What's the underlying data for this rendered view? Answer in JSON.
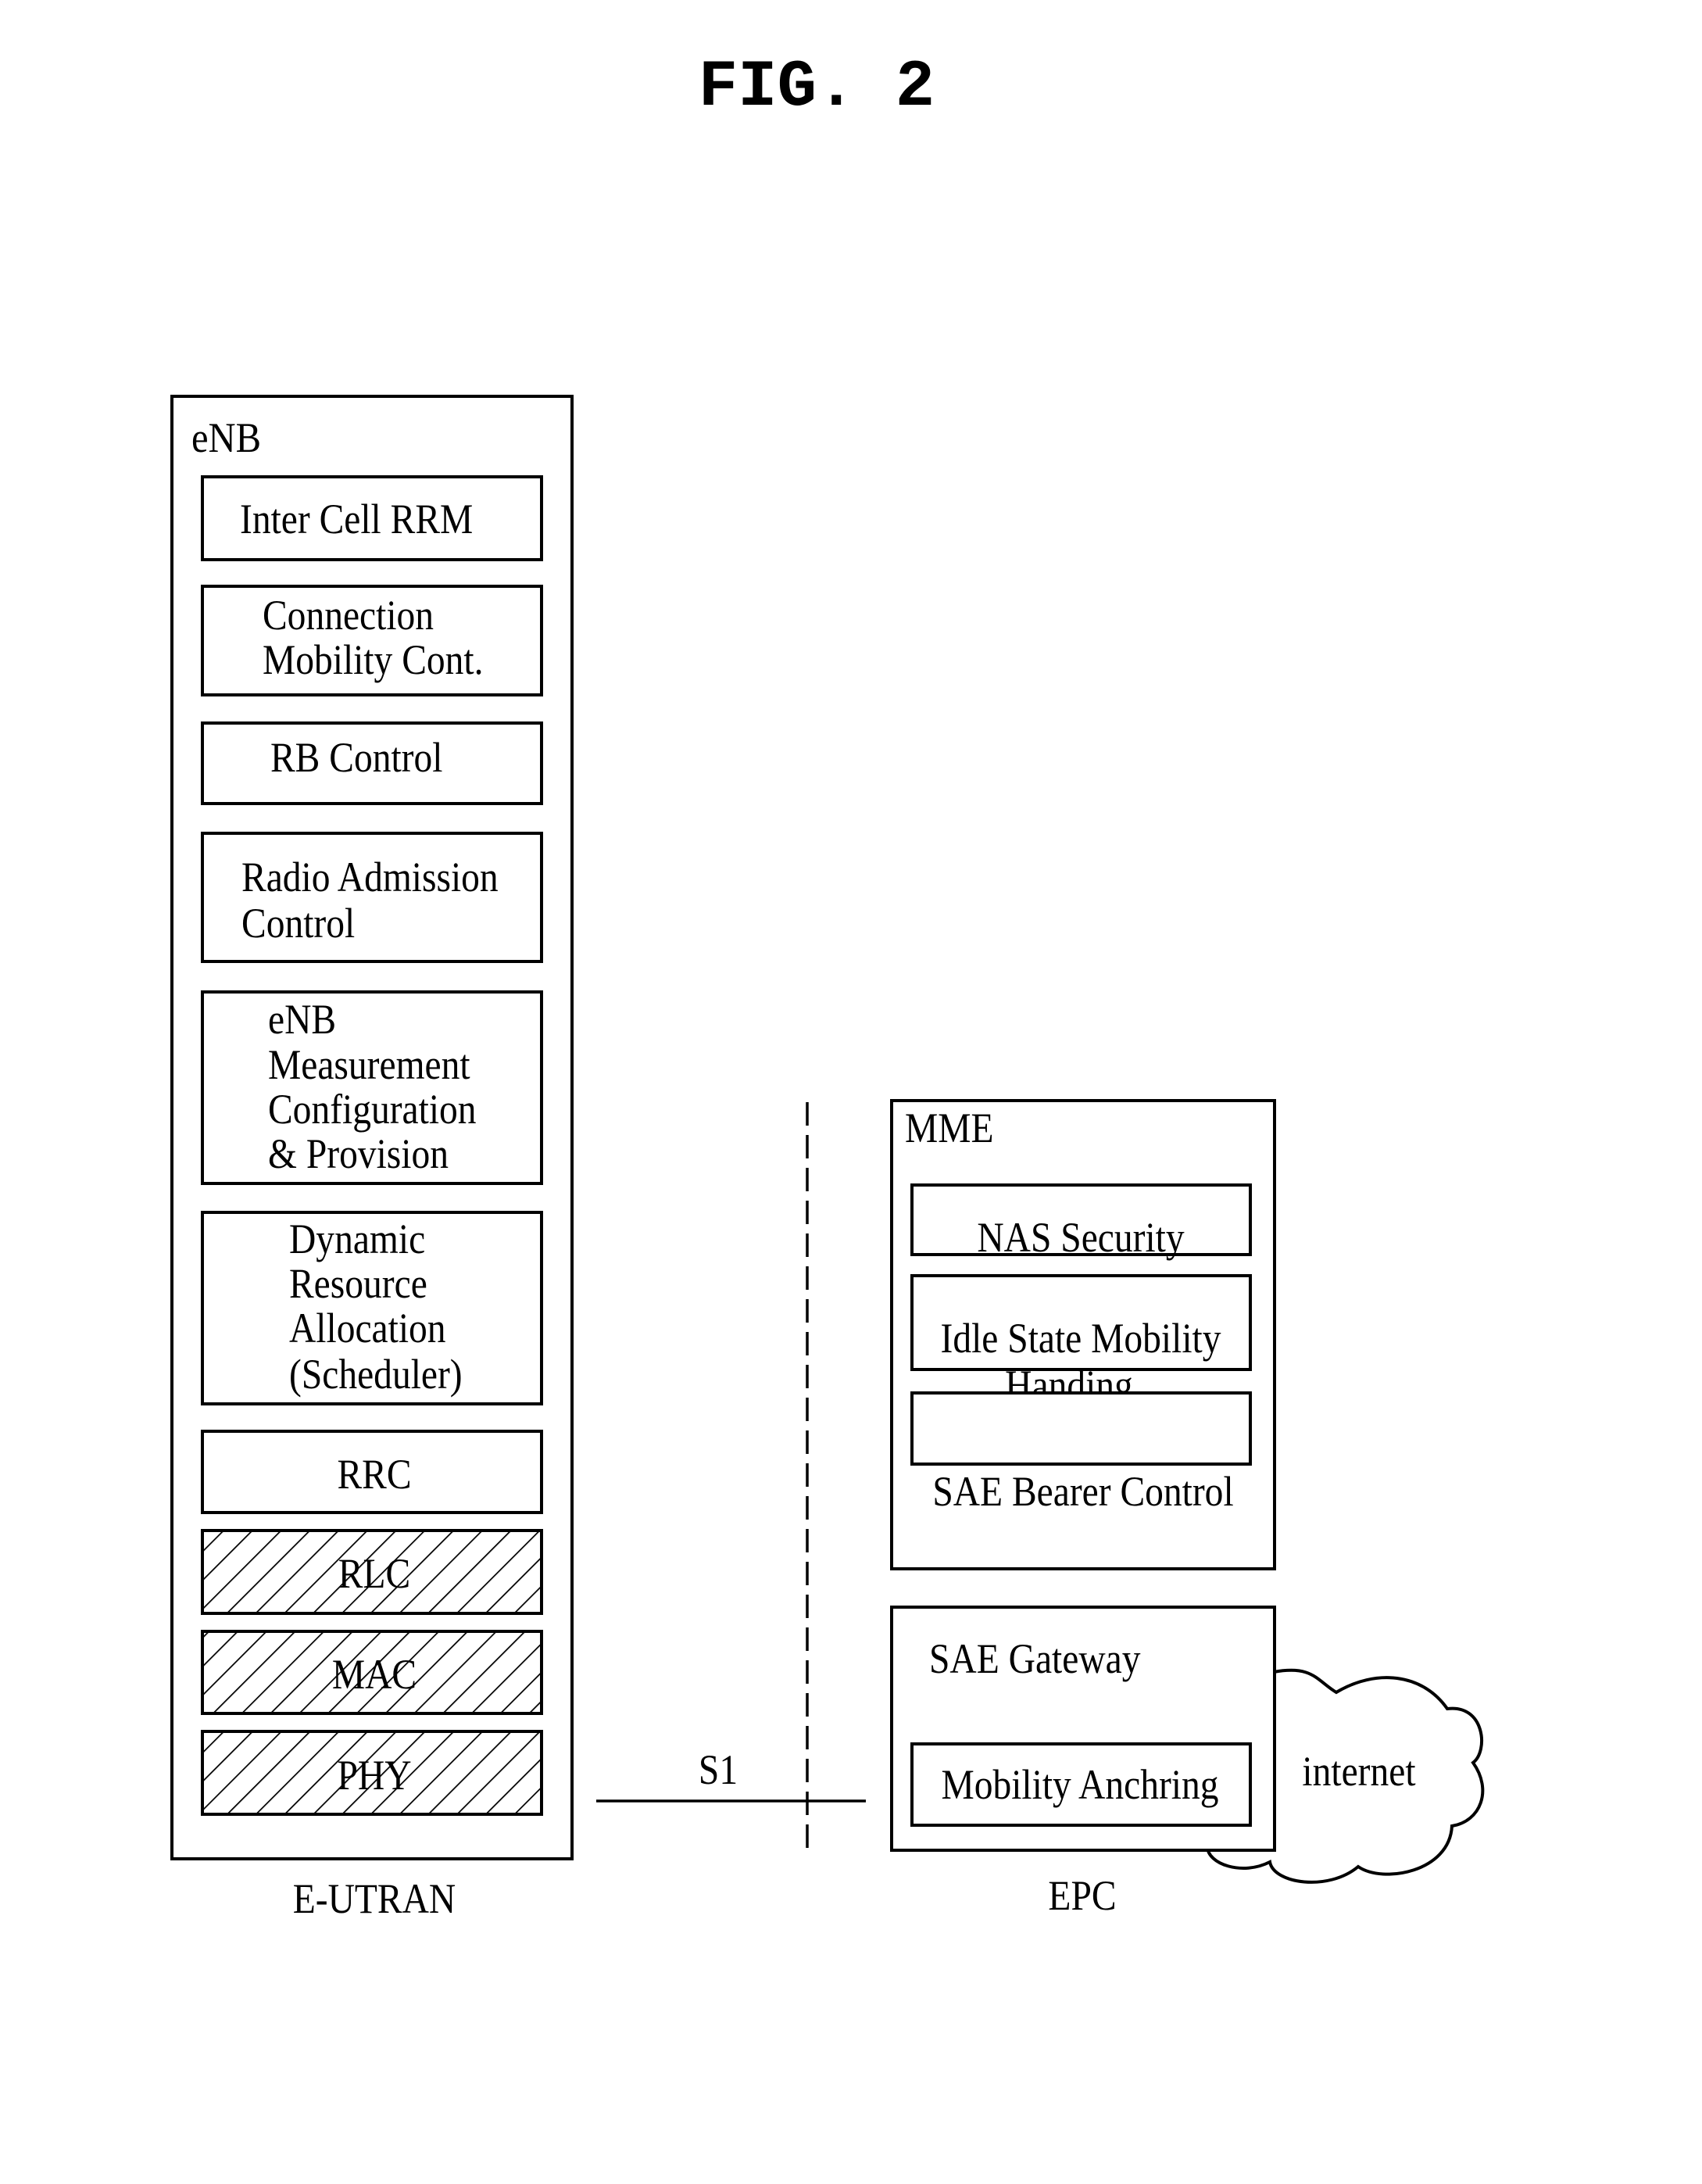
{
  "figure": {
    "title": "FIG. 2"
  },
  "eutran": {
    "caption": "E-UTRAN",
    "enb": {
      "label": "eNB",
      "functions": [
        {
          "lines": [
            "Inter Cell RRM"
          ],
          "hatched": false
        },
        {
          "lines": [
            "Connection",
            "Mobility Cont."
          ],
          "hatched": false
        },
        {
          "lines": [
            "RB Control"
          ],
          "hatched": false
        },
        {
          "lines": [
            "Radio Admission",
            "Control"
          ],
          "hatched": false
        },
        {
          "lines": [
            "eNB",
            "Measurement",
            "Configuration",
            "& Provision"
          ],
          "hatched": false
        },
        {
          "lines": [
            "Dynamic",
            "Resource",
            "Allocation",
            "(Scheduler)"
          ],
          "hatched": false
        },
        {
          "lines": [
            "RRC"
          ],
          "hatched": false
        },
        {
          "lines": [
            "RLC"
          ],
          "hatched": true
        },
        {
          "lines": [
            "MAC"
          ],
          "hatched": true
        },
        {
          "lines": [
            "PHY"
          ],
          "hatched": true
        }
      ]
    }
  },
  "interface": {
    "label": "S1"
  },
  "epc": {
    "caption": "EPC",
    "mme": {
      "label": "MME",
      "functions": [
        {
          "lines": [
            "NAS Security"
          ]
        },
        {
          "lines": [
            "Idle State Mobility",
            "Handing"
          ]
        },
        {
          "lines": [
            "SAE Bearer Control"
          ]
        }
      ]
    },
    "sae_gateway": {
      "label": "SAE Gateway",
      "functions": [
        {
          "lines": [
            "Mobility Anchring"
          ]
        }
      ]
    }
  },
  "internet": {
    "label": "internet"
  }
}
